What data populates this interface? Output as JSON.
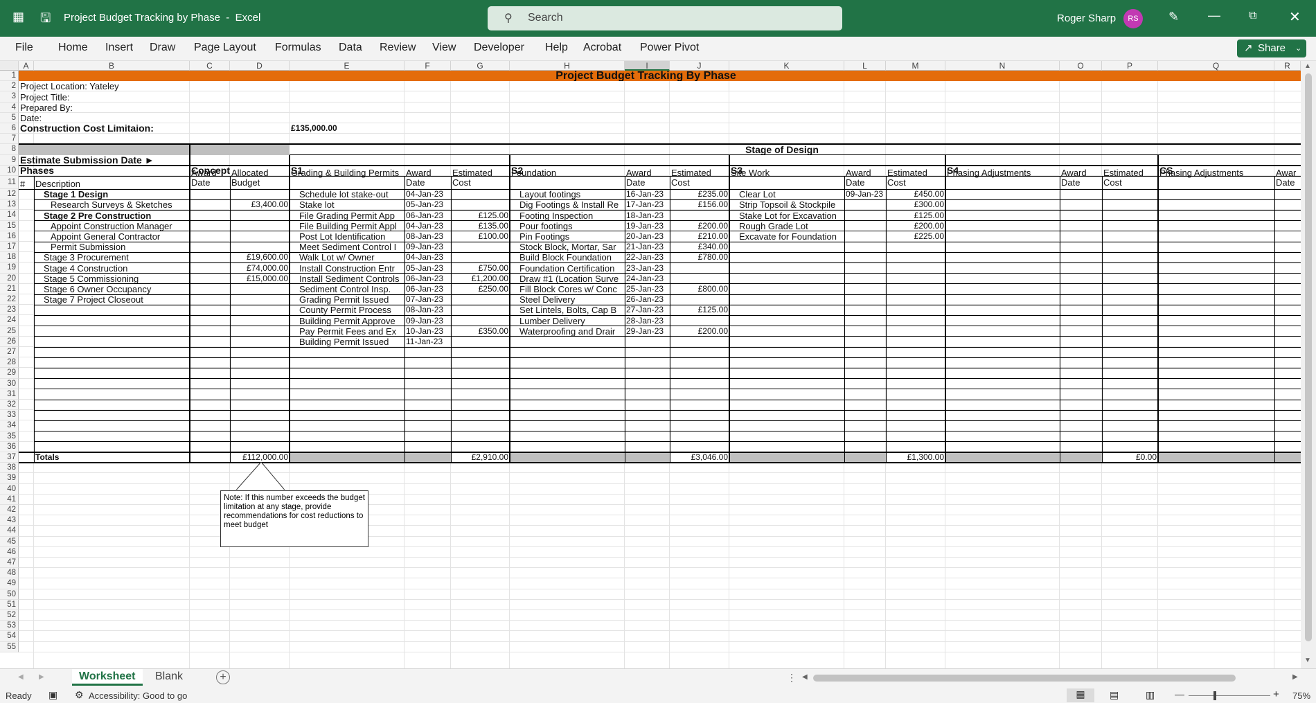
{
  "app": {
    "title": "Project Budget Tracking by Phase",
    "app_name": "Excel",
    "search_placeholder": "Search",
    "user_name": "Roger Sharp",
    "user_initials": "RS"
  },
  "ribbon": {
    "tabs": [
      "File",
      "Home",
      "Insert",
      "Draw",
      "Page Layout",
      "Formulas",
      "Data",
      "Review",
      "View",
      "Developer",
      "Help",
      "Acrobat",
      "Power Pivot"
    ],
    "share_label": "Share"
  },
  "columns": [
    "A",
    "B",
    "C",
    "D",
    "E",
    "F",
    "G",
    "H",
    "I",
    "J",
    "K",
    "L",
    "M",
    "N",
    "O",
    "P",
    "Q",
    "R"
  ],
  "rows": [
    "1",
    "2",
    "3",
    "4",
    "5",
    "6",
    "7",
    "8",
    "9",
    "10",
    "11",
    "12",
    "13",
    "14",
    "15",
    "16",
    "17",
    "18",
    "19",
    "20",
    "21",
    "22",
    "23",
    "24",
    "25",
    "26",
    "27",
    "28",
    "29",
    "30",
    "31",
    "32",
    "33",
    "34",
    "35",
    "36",
    "37",
    "38",
    "39",
    "40",
    "41",
    "42",
    "43",
    "44",
    "45",
    "46",
    "47",
    "48",
    "49",
    "50",
    "51",
    "52",
    "53",
    "54",
    "55"
  ],
  "sheet": {
    "title": "Project Budget Tracking By Phase",
    "location": "Project Location: Yateley",
    "project_title": "Project Title:",
    "prepared_by": "Prepared By:",
    "date": "Date:",
    "cost_limit_label": "Construction Cost Limitaion:",
    "cost_limit_value": "£135,000.00",
    "stage_of_design": "Stage of Design",
    "estimate_submission": "Estimate Submission Date ►",
    "phases": "Phases",
    "concept": "Concept",
    "s1": "S1",
    "s2": "S2",
    "s3": "S3",
    "s4": "S4",
    "cs": "CS",
    "hash": "#",
    "description": "Description",
    "award": "Award",
    "date_word": "Date",
    "allocated": "Allocated",
    "budget": "Budget",
    "estimated": "Estimated",
    "cost": "Cost",
    "s1_header": "Grading & Building Permits",
    "s2_header": "Foundation",
    "s3_header": "Site Work",
    "s4_header": "Phasing Adjustments",
    "cs_header": "Phasing Adjustments",
    "award_short": "Awar",
    "stages": [
      {
        "desc": "Stage 1 Design",
        "bold": true,
        "indent": 1,
        "budget": ""
      },
      {
        "desc": "Research Surveys & Sketches",
        "bold": false,
        "indent": 2,
        "budget": "£3,400.00"
      },
      {
        "desc": "Stage 2 Pre Construction",
        "bold": true,
        "indent": 1,
        "budget": ""
      },
      {
        "desc": "Appoint Construction Manager",
        "bold": false,
        "indent": 2,
        "budget": ""
      },
      {
        "desc": "Appoint General Contractor",
        "bold": false,
        "indent": 2,
        "budget": ""
      },
      {
        "desc": "Permit Submission",
        "bold": false,
        "indent": 2,
        "budget": ""
      },
      {
        "desc": "Stage 3 Procurement",
        "bold": false,
        "indent": 1,
        "budget": "£19,600.00"
      },
      {
        "desc": "Stage 4 Construction",
        "bold": false,
        "indent": 1,
        "budget": "£74,000.00"
      },
      {
        "desc": "Stage 5 Commissioning",
        "bold": false,
        "indent": 1,
        "budget": "£15,000.00"
      },
      {
        "desc": "Stage 6 Owner Occupancy",
        "bold": false,
        "indent": 1,
        "budget": ""
      },
      {
        "desc": "Stage 7 Project Closeout",
        "bold": false,
        "indent": 1,
        "budget": ""
      }
    ],
    "s1_items": [
      {
        "name": "Schedule lot stake-out",
        "date": "04-Jan-23",
        "cost": ""
      },
      {
        "name": "Stake lot",
        "date": "05-Jan-23",
        "cost": ""
      },
      {
        "name": "File Grading Permit App",
        "date": "06-Jan-23",
        "cost": "£125.00"
      },
      {
        "name": "File Building Permit Appl",
        "date": "04-Jan-23",
        "cost": "£135.00"
      },
      {
        "name": "Post Lot Identification",
        "date": "08-Jan-23",
        "cost": "£100.00"
      },
      {
        "name": "Meet Sediment Control I",
        "date": "09-Jan-23",
        "cost": ""
      },
      {
        "name": "Walk Lot w/ Owner",
        "date": "04-Jan-23",
        "cost": ""
      },
      {
        "name": "Install Construction Entr",
        "date": "05-Jan-23",
        "cost": "£750.00"
      },
      {
        "name": "Install Sediment Controls",
        "date": "06-Jan-23",
        "cost": "£1,200.00"
      },
      {
        "name": "Sediment Control Insp.",
        "date": "06-Jan-23",
        "cost": "£250.00"
      },
      {
        "name": "Grading Permit Issued",
        "date": "07-Jan-23",
        "cost": ""
      },
      {
        "name": "County Permit Process",
        "date": "08-Jan-23",
        "cost": ""
      },
      {
        "name": "Building Permit Approve",
        "date": "09-Jan-23",
        "cost": ""
      },
      {
        "name": "Pay Permit Fees and Ex",
        "date": "10-Jan-23",
        "cost": "£350.00"
      },
      {
        "name": "Building Permit Issued",
        "date": "11-Jan-23",
        "cost": ""
      }
    ],
    "s2_items": [
      {
        "name": "Layout footings",
        "date": "16-Jan-23",
        "cost": "£235.00"
      },
      {
        "name": "Dig Footings & Install Re",
        "date": "17-Jan-23",
        "cost": "£156.00"
      },
      {
        "name": "Footing Inspection",
        "date": "18-Jan-23",
        "cost": ""
      },
      {
        "name": "Pour footings",
        "date": "19-Jan-23",
        "cost": "£200.00"
      },
      {
        "name": "Pin Footings",
        "date": "20-Jan-23",
        "cost": "£210.00"
      },
      {
        "name": "Stock Block, Mortar, Sar",
        "date": "21-Jan-23",
        "cost": "£340.00"
      },
      {
        "name": "Build Block Foundation",
        "date": "22-Jan-23",
        "cost": "£780.00"
      },
      {
        "name": "Foundation Certification",
        "date": "23-Jan-23",
        "cost": ""
      },
      {
        "name": "Draw #1 (Location Surve",
        "date": "24-Jan-23",
        "cost": ""
      },
      {
        "name": "Fill Block Cores w/ Conc",
        "date": "25-Jan-23",
        "cost": "£800.00"
      },
      {
        "name": "Steel Delivery",
        "date": "26-Jan-23",
        "cost": ""
      },
      {
        "name": "Set Lintels, Bolts, Cap B",
        "date": "27-Jan-23",
        "cost": "£125.00"
      },
      {
        "name": "Lumber Delivery",
        "date": "28-Jan-23",
        "cost": ""
      },
      {
        "name": "Waterproofing and Drair",
        "date": "29-Jan-23",
        "cost": "£200.00"
      }
    ],
    "s3_items": [
      {
        "name": "Clear Lot",
        "date": "09-Jan-23",
        "cost": "£450.00"
      },
      {
        "name": "Strip Topsoil & Stockpile",
        "date": "",
        "cost": "£300.00"
      },
      {
        "name": "Stake Lot for Excavation",
        "date": "",
        "cost": "£125.00"
      },
      {
        "name": "Rough Grade Lot",
        "date": "",
        "cost": "£200.00"
      },
      {
        "name": "Excavate for Foundation",
        "date": "",
        "cost": "£225.00"
      }
    ],
    "totals_label": "Totals",
    "total_budget": "£112,000.00",
    "total_s1": "£2,910.00",
    "total_s2": "£3,046.00",
    "total_s3": "£1,300.00",
    "total_s4": "£0.00",
    "note": "Note:  If this number exceeds the budget limitation at any stage, provide recommendations for cost reductions to meet budget"
  },
  "tabs": {
    "sheet1": "Worksheet",
    "sheet2": "Blank"
  },
  "status": {
    "ready": "Ready",
    "accessibility": "Accessibility: Good to go",
    "zoom": "75%"
  }
}
